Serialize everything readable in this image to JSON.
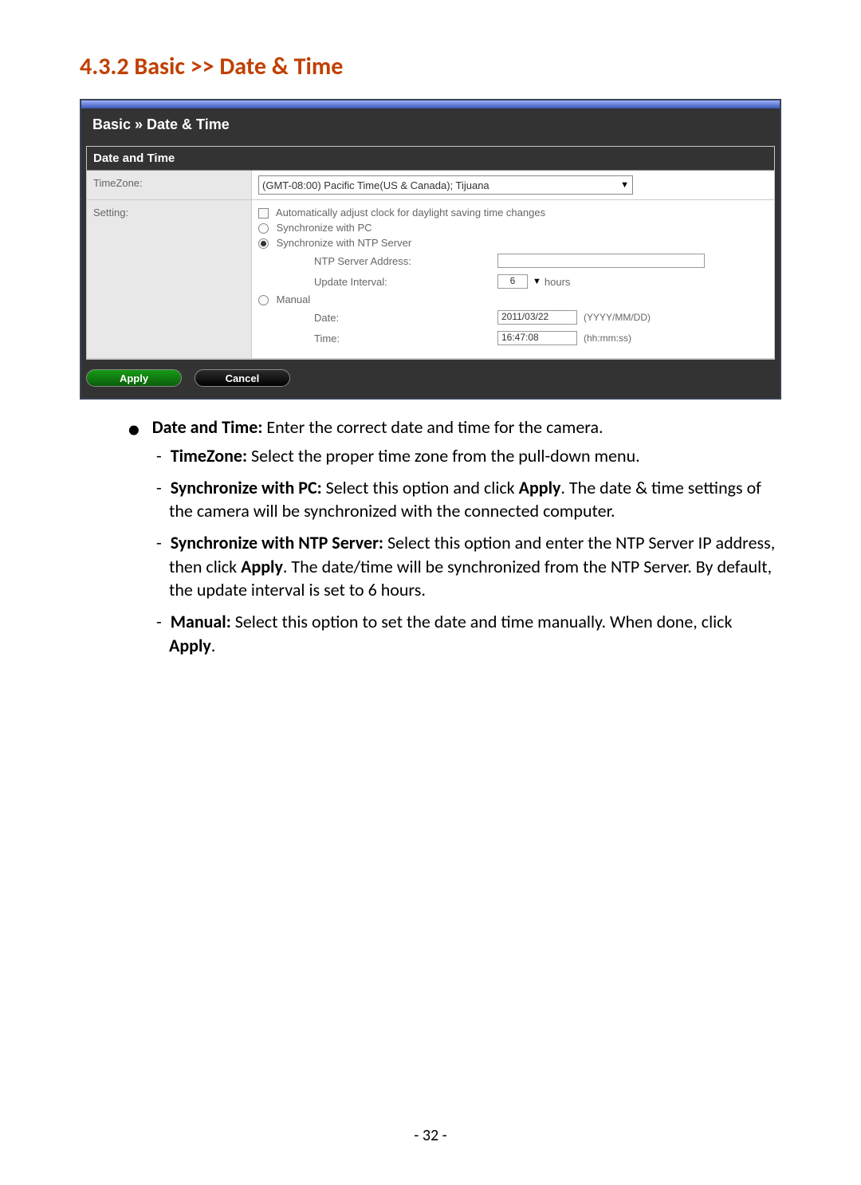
{
  "heading": "4.3.2   Basic >> Date & Time",
  "panel": {
    "title": "Basic » Date & Time",
    "subtitle": "Date and Time",
    "rows": {
      "timezone_label": "TimeZone:",
      "timezone_value": "(GMT-08:00) Pacific Time(US & Canada); Tijuana",
      "setting_label": "Setting:"
    },
    "setting": {
      "dst": "Automatically adjust clock for daylight saving time changes",
      "sync_pc": "Synchronize with PC",
      "sync_ntp": "Synchronize with NTP Server",
      "ntp_addr_label": "NTP Server Address:",
      "update_label": "Update Interval:",
      "update_value": "6",
      "update_unit": "hours",
      "manual": "Manual",
      "date_label": "Date:",
      "date_value": "2011/03/22",
      "date_hint": "(YYYY/MM/DD)",
      "time_label": "Time:",
      "time_value": "16:47:08",
      "time_hint": "(hh:mm:ss)"
    },
    "buttons": {
      "apply": "Apply",
      "cancel": "Cancel"
    }
  },
  "desc": {
    "d1_b": "Date and Time:",
    "d1_t": " Enter the correct date and time for the camera.",
    "tz_b": "TimeZone:",
    "tz_t": " Select the proper time zone from the pull-down menu.",
    "pc_b": "Synchronize with PC:",
    "pc_t1": " Select this option and click ",
    "pc_apply": "Apply",
    "pc_t2": ". The date & time settings of the camera will be synchronized with the connected computer.",
    "ntp_b": "Synchronize with NTP Server:",
    "ntp_t1": " Select this option and enter the NTP Server IP address, then click ",
    "ntp_apply": "Apply",
    "ntp_t2": ". The date/time will be synchronized from the NTP Server. By default, the update interval is set to 6 hours.",
    "man_b": "Manual:",
    "man_t1": " Select this option to set the date and time manually. When done, click ",
    "man_apply": "Apply",
    "man_t2": "."
  },
  "pageno": "- 32 -"
}
